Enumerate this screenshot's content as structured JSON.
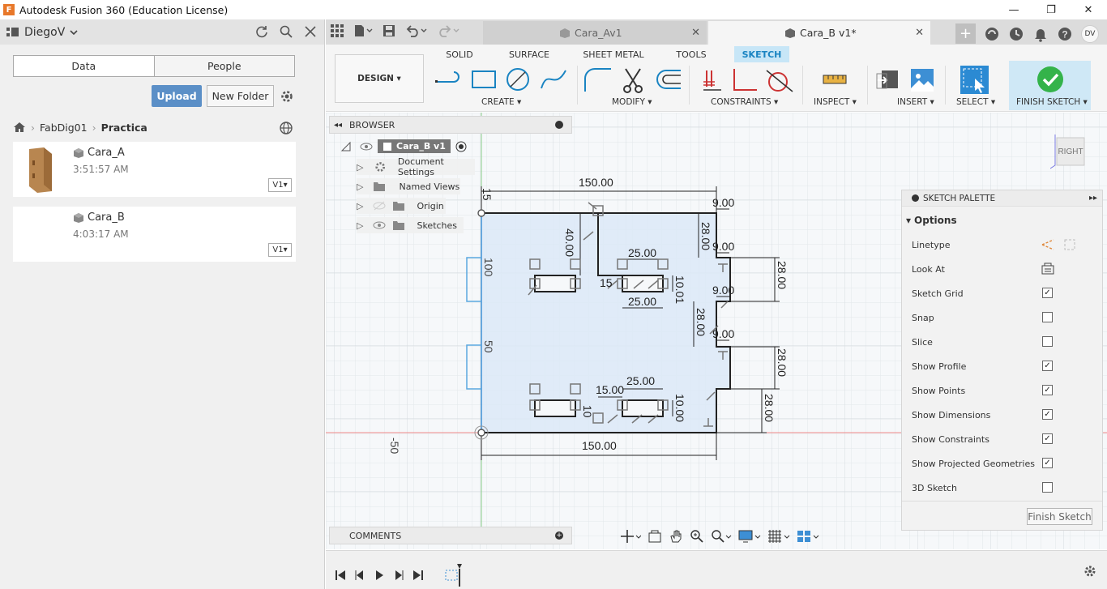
{
  "window": {
    "title": "Autodesk Fusion 360 (Education License)",
    "app_icon_letter": "F",
    "controls": [
      "—",
      "❐",
      "✕"
    ]
  },
  "data_panel": {
    "user": "DiegoV",
    "tabs": [
      "Data",
      "People"
    ],
    "upload_label": "Upload",
    "new_folder_label": "New Folder",
    "breadcrumb": [
      "FabDig01",
      "Practica"
    ],
    "files": [
      {
        "name": "Cara_A",
        "time": "3:51:57 AM",
        "version": "V1"
      },
      {
        "name": "Cara_B",
        "time": "4:03:17 AM",
        "version": "V1"
      }
    ]
  },
  "doc_tabs": [
    {
      "label": "Cara_Av1",
      "active": false
    },
    {
      "label": "Cara_B v1*",
      "active": true
    }
  ],
  "avatar_initials": "DV",
  "toolbar": {
    "design_label": "DESIGN",
    "workspace_tabs": [
      "SOLID",
      "SURFACE",
      "SHEET METAL",
      "TOOLS",
      "SKETCH"
    ],
    "active_tab": "SKETCH",
    "groups": [
      "CREATE",
      "MODIFY",
      "CONSTRAINTS",
      "INSPECT",
      "INSERT",
      "SELECT",
      "FINISH SKETCH"
    ]
  },
  "browser": {
    "title": "BROWSER",
    "root": "Cara_B v1",
    "items": [
      "Document Settings",
      "Named Views",
      "Origin",
      "Sketches"
    ]
  },
  "viewcube": {
    "face": "RIGHT",
    "axis": "Z"
  },
  "sketch": {
    "dims": {
      "top_width": "150.00",
      "bottom_width": "150.00",
      "left_top": "15",
      "right_steps": [
        "9.00",
        "9.00",
        "9.00",
        "9.00"
      ],
      "right_heights": [
        "28.00",
        "28.00",
        "28.00",
        "28.00"
      ],
      "top_slot_w": "25.00",
      "top_slot_w2": "25.00",
      "top_slot_h": "10.01",
      "top_slot_x": "40.00",
      "bottom_slot_w": "25.00",
      "bottom_slot_x": "15.00",
      "bottom_slot_h": "10.00",
      "small_15": "15",
      "small_10": "10",
      "left_28": "28.00",
      "top_28": "28.00"
    },
    "ruler": [
      "100",
      "50",
      "-50"
    ]
  },
  "palette": {
    "title": "SKETCH PALETTE",
    "section": "Options",
    "rows": [
      {
        "label": "Linetype",
        "type": "icons"
      },
      {
        "label": "Look At",
        "type": "icon"
      },
      {
        "label": "Sketch Grid",
        "checked": true
      },
      {
        "label": "Snap",
        "checked": false
      },
      {
        "label": "Slice",
        "checked": false
      },
      {
        "label": "Show Profile",
        "checked": true
      },
      {
        "label": "Show Points",
        "checked": true
      },
      {
        "label": "Show Dimensions",
        "checked": true
      },
      {
        "label": "Show Constraints",
        "checked": true
      },
      {
        "label": "Show Projected Geometries",
        "checked": true
      },
      {
        "label": "3D Sketch",
        "checked": false
      }
    ],
    "finish_label": "Finish Sketch"
  },
  "comments_label": "COMMENTS"
}
